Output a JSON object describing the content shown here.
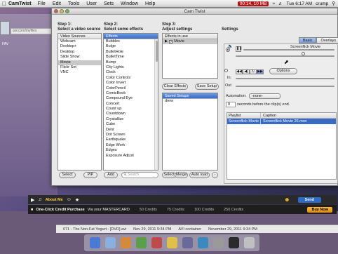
{
  "menubar": {
    "app_name": "CamTwist",
    "items": [
      "File",
      "Edit",
      "Tools",
      "User",
      "Sets",
      "Window",
      "Help"
    ],
    "recording": "00:14, 10 MB",
    "clock": "Tue 6:17 AM",
    "user": "crump"
  },
  "window": {
    "title": "Cam Twist",
    "step1": {
      "line1": "Step 1:",
      "line2": "Select a video source"
    },
    "step2": {
      "line1": "Step 2:",
      "line2": "Select some effects"
    },
    "step3": {
      "line1": "Step 3:",
      "line2": "Adjust settings"
    },
    "settings_label": "Settings",
    "sources": {
      "header": "Video Sources",
      "items": [
        "Webcam",
        "Desktop+",
        "Desktop",
        "Slide Show",
        "Movie",
        "Flickr Set",
        "VNC"
      ],
      "selected": "Movie"
    },
    "effects": {
      "header": "Effects",
      "items": [
        "Bubbles",
        "Bulge",
        "BulletHole",
        "BulletTime",
        "Bump",
        "City Lights",
        "Clock",
        "Color Controls",
        "Color Invert",
        "ColorPencil",
        "ComicBook",
        "Compound Eye",
        "Concert",
        "Count up",
        "Countdown",
        "Crystallize",
        "Cube",
        "Dent",
        "Dot Screen",
        "Earthquake",
        "Edge Work",
        "Edges",
        "Exposure Adjust"
      ]
    },
    "in_use": {
      "header": "Effects in use",
      "items": [
        "Movie"
      ]
    },
    "saved": {
      "header": "Saved Setups",
      "items": [
        "drew"
      ]
    },
    "buttons": {
      "select": "Select",
      "pip": "PIP",
      "add": "Add",
      "clear_effects": "Clear Effects",
      "save_setup": "Save Setup",
      "select2": "Select",
      "merge": "Merge",
      "auto_load": "Auto load",
      "minus": "-",
      "options": "Options"
    },
    "search_placeholder": "Search",
    "tabs": [
      "Basic",
      "Overlays"
    ],
    "active_tab": "Basic",
    "movie_title": "Screenflick Movie",
    "in_label": "In:",
    "out_label": "Out",
    "automation_label": "Automation:",
    "automation_value": "-none-",
    "seconds_value": "0",
    "seconds_label": "seconds before the clip(s) end.",
    "table": {
      "col_playlist": "Playlist",
      "col_caption": "Caption",
      "rows": [
        {
          "playlist": "Screenflick Movie",
          "caption": "Screenflick Movie 26.mov"
        }
      ]
    }
  },
  "background": {
    "url_text": "aol.com/myfiles",
    "fav_text": "FAV",
    "player": {
      "about_me": "About Me",
      "send": "Send"
    },
    "credits": {
      "purchase": "One-Click Credit Purchase",
      "via": "Via your MASTERCARD",
      "options": [
        "50 Credits",
        "75 Credits",
        "100 Credits",
        "250 Credits"
      ],
      "buy": "Buy Now"
    },
    "finder": {
      "file": "071 - The Non-Fat Yogurt - [DVD].avi",
      "date1": "Nov 29, 2011 9:34 PM",
      "kind": "AVI container",
      "date2": "November 29, 2011 9:34 PM"
    }
  },
  "colors": {
    "selection": "#3a6ac4",
    "close": "#e05a4a",
    "minimize": "#e8b83a",
    "zoom": "#6ab84a"
  }
}
